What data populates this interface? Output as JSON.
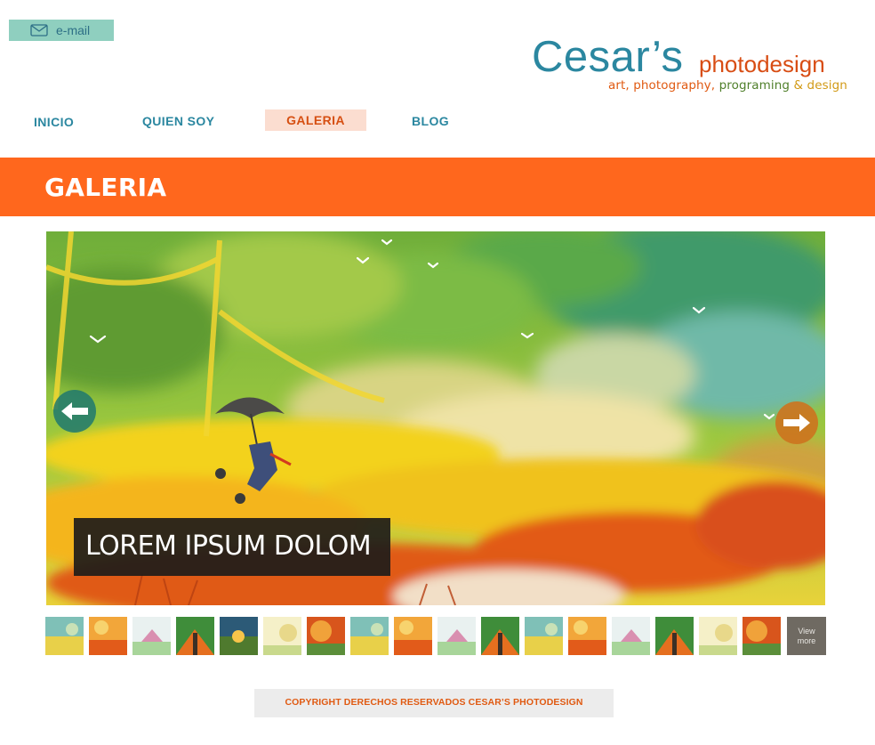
{
  "header": {
    "email_label": "e-mail",
    "logo": {
      "name": "Cesar’s",
      "word": "photodesign",
      "tagline": [
        {
          "text": "art,",
          "color": "#e05a12"
        },
        {
          "text": "photography,",
          "color": "#e05a12"
        },
        {
          "text": "programing",
          "color": "#4f7f2a"
        },
        {
          "text": "&",
          "color": "#d29a16"
        },
        {
          "text": "design",
          "color": "#d29a16"
        }
      ]
    }
  },
  "nav": {
    "items": [
      {
        "label": "INICIO",
        "active": false
      },
      {
        "label": "QUIEN SOY",
        "active": false
      },
      {
        "label": "GALERIA",
        "active": true
      },
      {
        "label": "BLOG",
        "active": false
      }
    ]
  },
  "banner": {
    "title": "GALERIA",
    "color": "#ff671d"
  },
  "slider": {
    "caption": "LOREM IPSUM DOLOM",
    "prev_icon": "arrow-left-icon",
    "next_icon": "arrow-right-icon"
  },
  "thumbnails": {
    "view_more_line1": "View",
    "view_more_line2": "more",
    "count": 17
  },
  "footer": {
    "text": "COPYRIGHT DERECHOS RESERVADOS  CESAR’S PHOTODESIGN"
  },
  "colors": {
    "accent": "#ff671d",
    "teal": "#2b87a0",
    "email_bg": "#8fcfbf"
  }
}
